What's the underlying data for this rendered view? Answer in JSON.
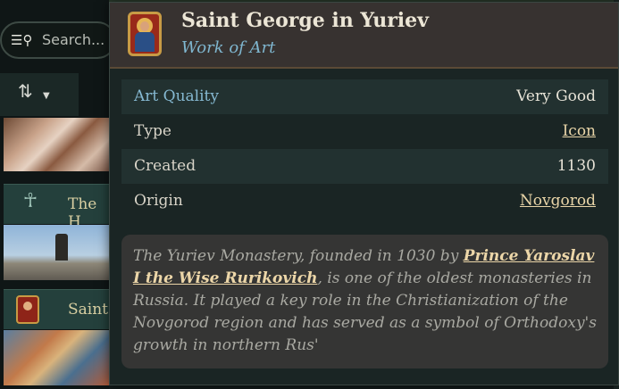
{
  "search": {
    "placeholder": "Search..."
  },
  "list": {
    "cards": [
      {
        "title": "The H"
      },
      {
        "title": "Saint"
      }
    ]
  },
  "tooltip": {
    "title": "Saint George in Yuriev",
    "subtitle": "Work of Art",
    "rows": [
      {
        "label": "Art Quality",
        "value": "Very Good"
      },
      {
        "label": "Type",
        "value": "Icon"
      },
      {
        "label": "Created",
        "value": "1130"
      },
      {
        "label": "Origin",
        "value": "Novgorod"
      }
    ],
    "description": {
      "before": "The Yuriev Monastery, founded in 1030 by ",
      "link": "Prince Yaroslav I the Wise Rurikovich",
      "after": ", is one of the oldest monasteries in Russia. It played a key role in the Christianization of the Novgorod region and has served as a symbol of Orthodoxy's growth in northern Rus'"
    }
  },
  "colors": {
    "accent_blue": "#86b9d2",
    "link_gold": "#e9d5a8",
    "header_bg": "#373230"
  }
}
